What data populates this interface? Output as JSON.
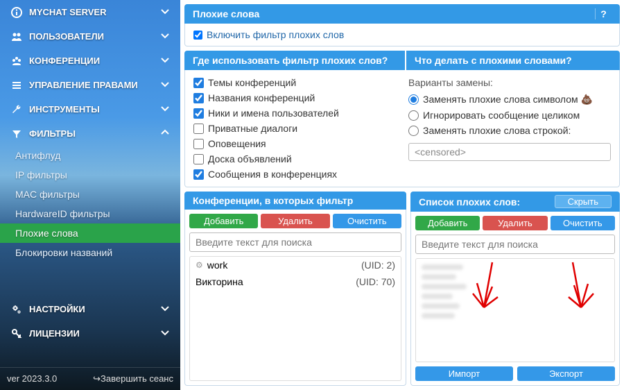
{
  "sidebar": {
    "items": [
      {
        "icon": "info",
        "label": "MYCHAT SERVER",
        "open": false
      },
      {
        "icon": "users",
        "label": "ПОЛЬЗОВАТЕЛИ",
        "open": false
      },
      {
        "icon": "group",
        "label": "КОНФЕРЕНЦИИ",
        "open": false
      },
      {
        "icon": "list",
        "label": "УПРАВЛЕНИЕ ПРАВАМИ",
        "open": false
      },
      {
        "icon": "wrench",
        "label": "ИНСТРУМЕНТЫ",
        "open": false
      },
      {
        "icon": "filter",
        "label": "ФИЛЬТРЫ",
        "open": true
      }
    ],
    "filters_sub": [
      {
        "label": "Антифлуд"
      },
      {
        "label": "IP фильтры"
      },
      {
        "label": "MAC фильтры"
      },
      {
        "label": "HardwareID фильтры"
      },
      {
        "label": "Плохие слова",
        "active": true
      },
      {
        "label": "Блокировки названий"
      }
    ],
    "bottom_items": [
      {
        "icon": "cogs",
        "label": "НАСТРОЙКИ",
        "open": false
      },
      {
        "icon": "key",
        "label": "ЛИЦЕНЗИИ",
        "open": false
      }
    ],
    "version": "ver 2023.3.0",
    "logout_icon": "↪",
    "logout": "Завершить сеанс"
  },
  "header": {
    "title": "Плохие слова",
    "help": "?",
    "enable_label": "Включить фильтр плохих слов",
    "enable_checked": true
  },
  "where": {
    "title": "Где использовать фильтр плохих слов?",
    "options": [
      {
        "label": "Темы конференций",
        "checked": true
      },
      {
        "label": "Названия конференций",
        "checked": true
      },
      {
        "label": "Ники и имена пользователей",
        "checked": true
      },
      {
        "label": "Приватные диалоги",
        "checked": false
      },
      {
        "label": "Оповещения",
        "checked": false
      },
      {
        "label": "Доска объявлений",
        "checked": false
      },
      {
        "label": "Сообщения в конференциях",
        "checked": true
      }
    ]
  },
  "action": {
    "title": "Что делать с плохими словами?",
    "variants_label": "Варианты замены:",
    "radios": [
      {
        "label": "Заменять плохие слова символом 💩",
        "checked": true
      },
      {
        "label": "Игнорировать сообщение целиком",
        "checked": false
      },
      {
        "label": "Заменять плохие слова строкой:",
        "checked": false
      }
    ],
    "replace_value": "<censored>"
  },
  "conferences": {
    "title": "Конференции, в которых фильтр",
    "add": "Добавить",
    "delete": "Удалить",
    "clear": "Очистить",
    "search_placeholder": "Введите текст для поиска",
    "rows": [
      {
        "name": "work",
        "uid": "(UID: 2)",
        "gear": true
      },
      {
        "name": "Викторина",
        "uid": "(UID: 70)",
        "gear": false
      }
    ]
  },
  "badwords": {
    "title": "Список плохих слов:",
    "hide": "Скрыть",
    "add": "Добавить",
    "delete": "Удалить",
    "clear": "Очистить",
    "search_placeholder": "Введите текст для поиска",
    "import": "Импорт",
    "export": "Экспорт"
  }
}
